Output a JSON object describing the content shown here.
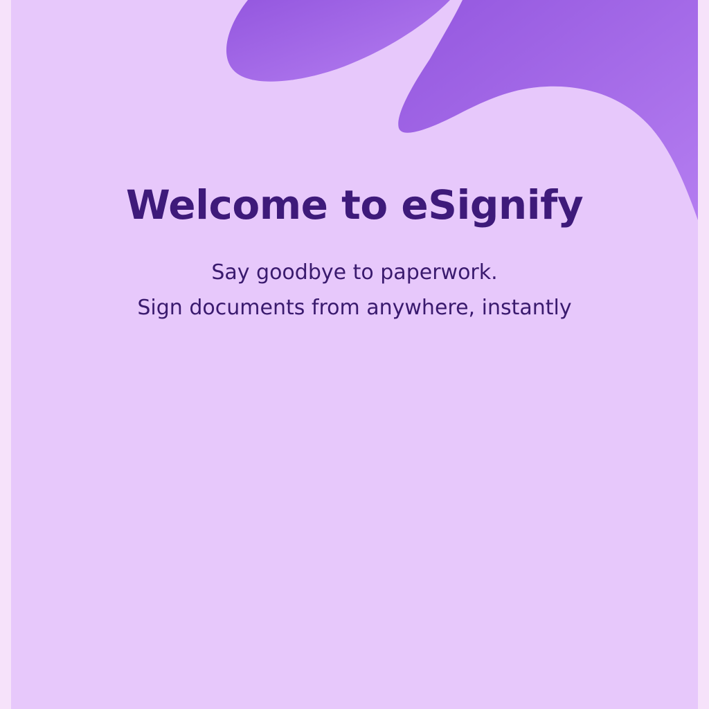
{
  "welcome": {
    "title": "Welcome to eSignify",
    "tagline_line1": "Say goodbye to paperwork.",
    "tagline_line2": "Sign documents from anywhere, instantly"
  },
  "colors": {
    "page_edge": "#f6e2fa",
    "background": "#e7c8fb",
    "blob_start": "#9457df",
    "blob_end": "#b47df0",
    "title_text": "#3e1a7a",
    "body_text": "#3a1a6e"
  }
}
